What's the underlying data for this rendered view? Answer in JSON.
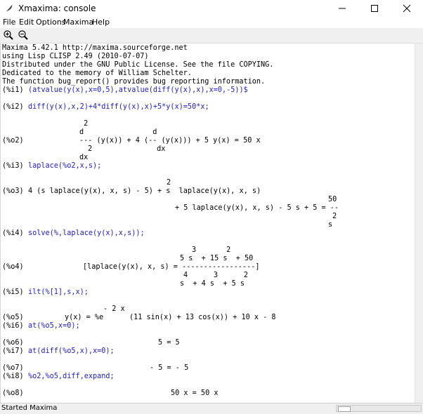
{
  "window": {
    "title": "Xmaxima: console"
  },
  "menu": {
    "items": [
      "File",
      "Edit",
      "Options",
      "Maxima",
      "Help"
    ]
  },
  "banner": [
    "Maxima 5.42.1 http://maxima.sourceforge.net",
    "using Lisp CLISP 2.49 (2010-07-07)",
    "Distributed under the GNU Public License. See the file COPYING.",
    "Dedicated to the memory of William Schelter.",
    "The function bug_report() provides bug reporting information."
  ],
  "session": {
    "i1": {
      "label": "(%i1)",
      "input": "(atvalue(y(x),x=0,5),atvalue(diff(y(x),x),x=0,-5))$"
    },
    "i2": {
      "label": "(%i2)",
      "input": "diff(y(x),x,2)+4*diff(y(x),x)+5*y(x)=50*x;"
    },
    "o2": {
      "label": "(%o2)",
      "l1": "2",
      "l2": "d                d",
      "l3": "--- (y(x)) + 4 (-- (y(x))) + 5 y(x) = 50 x",
      "l4": "2               dx",
      "l5": "dx"
    },
    "i3": {
      "label": "(%i3)",
      "input": "laplace(%o2,x,s);"
    },
    "o3": {
      "label": "(%o3)",
      "l1": "2",
      "l2": "4 (s laplace(y(x), x, s) - 5) + s  laplace(y(x), x, s)",
      "l3": "50",
      "l4": "+ 5 laplace(y(x), x, s) - 5 s + 5 = --",
      "l5": "2",
      "l6": "s"
    },
    "i4": {
      "label": "(%i4)",
      "input": "solve(%,laplace(y(x),x,s));"
    },
    "o4": {
      "label": "(%o4)",
      "l1": "3       2",
      "l2": "5 s  + 15 s  + 50",
      "l3": "[laplace(y(x), x, s) = -----------------]",
      "l4": "4      3      2",
      "l5": "s  + 4 s  + 5 s"
    },
    "i5": {
      "label": "(%i5)",
      "input": "ilt(%[1],s,x);"
    },
    "o5": {
      "label": "(%o5)",
      "l1": "- 2 x",
      "l2": "y(x) = %e      (11 sin(x) + 13 cos(x)) + 10 x - 8"
    },
    "i6": {
      "label": "(%i6)",
      "input": "at(%o5,x=0);"
    },
    "o6": {
      "label": "(%o6)",
      "text": "5 = 5"
    },
    "i7": {
      "label": "(%i7)",
      "input": "at(diff(%o5,x),x=0);"
    },
    "o7": {
      "label": "(%o7)",
      "text": "- 5 = - 5"
    },
    "i8": {
      "label": "(%i8)",
      "input": "%o2,%o5,diff,expand;"
    },
    "o8": {
      "label": "(%o8)",
      "text": "50 x = 50 x"
    }
  },
  "status": {
    "text": "Started Maxima"
  },
  "colors": {
    "input": "#2020c8",
    "output": "#000000",
    "toolbar": "#f0f0f0"
  },
  "icons": [
    "feather-icon",
    "minimize-icon",
    "maximize-icon",
    "close-icon",
    "zoom-in-icon",
    "zoom-out-icon"
  ]
}
